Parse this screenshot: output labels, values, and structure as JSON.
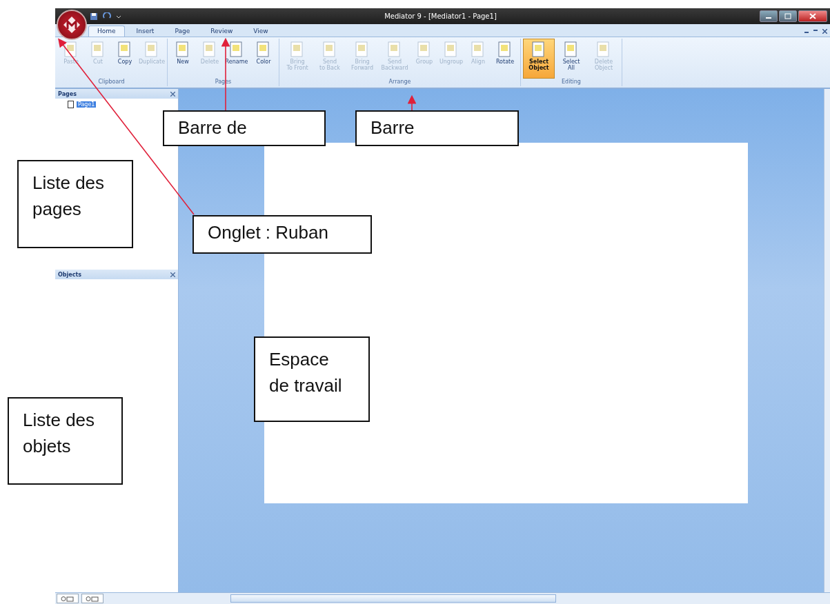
{
  "window": {
    "title": "Mediator 9 - [Mediator1 - Page1]"
  },
  "tabs": [
    {
      "label": "Home",
      "selected": true
    },
    {
      "label": "Insert",
      "selected": false
    },
    {
      "label": "Page",
      "selected": false
    },
    {
      "label": "Review",
      "selected": false
    },
    {
      "label": "View",
      "selected": false
    }
  ],
  "ribbon": {
    "groups": [
      {
        "name": "Clipboard",
        "buttons": [
          {
            "lines": [
              "Paste"
            ],
            "disabled": true,
            "selected": false
          },
          {
            "lines": [
              "Cut"
            ],
            "disabled": true,
            "selected": false
          },
          {
            "lines": [
              "Copy"
            ],
            "disabled": false,
            "selected": false
          },
          {
            "lines": [
              "Duplicate"
            ],
            "disabled": true,
            "selected": false
          }
        ]
      },
      {
        "name": "Pages",
        "buttons": [
          {
            "lines": [
              "New"
            ],
            "disabled": false,
            "selected": false
          },
          {
            "lines": [
              "Delete"
            ],
            "disabled": true,
            "selected": false
          },
          {
            "lines": [
              "Rename"
            ],
            "disabled": false,
            "selected": false
          },
          {
            "lines": [
              "Color"
            ],
            "disabled": false,
            "selected": false
          }
        ]
      },
      {
        "name": "Arrange",
        "buttons": [
          {
            "lines": [
              "Bring",
              "To Front"
            ],
            "disabled": true,
            "selected": false
          },
          {
            "lines": [
              "Send",
              "to Back"
            ],
            "disabled": true,
            "selected": false
          },
          {
            "lines": [
              "Bring",
              "Forward"
            ],
            "disabled": true,
            "selected": false
          },
          {
            "lines": [
              "Send",
              "Backward"
            ],
            "disabled": true,
            "selected": false
          },
          {
            "lines": [
              "Group"
            ],
            "disabled": true,
            "selected": false
          },
          {
            "lines": [
              "Ungroup"
            ],
            "disabled": true,
            "selected": false
          },
          {
            "lines": [
              "Align"
            ],
            "disabled": true,
            "selected": false
          },
          {
            "lines": [
              "Rotate"
            ],
            "disabled": false,
            "selected": false
          }
        ]
      },
      {
        "name": "Editing",
        "buttons": [
          {
            "lines": [
              "Select",
              "Object"
            ],
            "disabled": false,
            "selected": true
          },
          {
            "lines": [
              "Select",
              "All"
            ],
            "disabled": false,
            "selected": false
          },
          {
            "lines": [
              "Delete",
              "Object"
            ],
            "disabled": true,
            "selected": false
          }
        ]
      }
    ]
  },
  "pages_panel": {
    "title": "Pages",
    "items": [
      {
        "label": "Page1",
        "selected": true
      }
    ]
  },
  "objects_panel": {
    "title": "Objects"
  },
  "annotations": [
    {
      "lines": [
        "Barre de"
      ]
    },
    {
      "lines": [
        "Barre"
      ]
    },
    {
      "lines": [
        "Liste des",
        "pages"
      ]
    },
    {
      "lines": [
        "Onglet : Ruban"
      ]
    },
    {
      "lines": [
        "Espace",
        "de travail"
      ]
    },
    {
      "lines": [
        "Liste des",
        "objets"
      ]
    }
  ]
}
